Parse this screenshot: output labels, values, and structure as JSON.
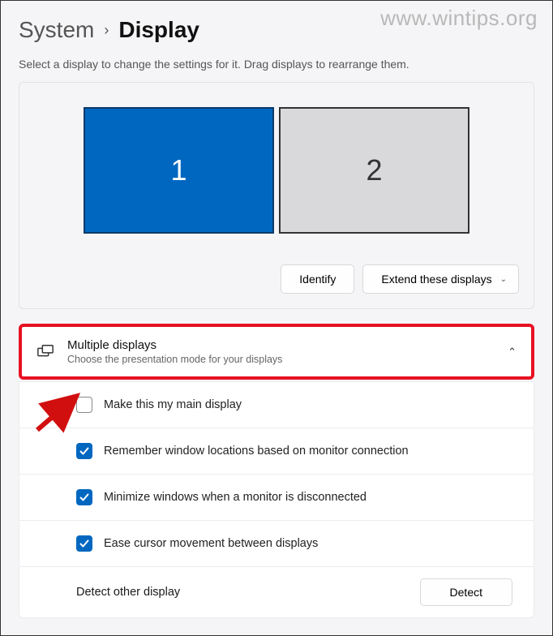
{
  "watermark": "www.wintips.org",
  "breadcrumb": {
    "parent": "System",
    "current": "Display"
  },
  "instruction": "Select a display to change the settings for it. Drag displays to rearrange them.",
  "monitors": {
    "m1": "1",
    "m2": "2"
  },
  "actions": {
    "identify": "Identify",
    "extend": "Extend these displays"
  },
  "section": {
    "title": "Multiple displays",
    "subtitle": "Choose the presentation mode for your displays"
  },
  "options": {
    "main_display": "Make this my main display",
    "remember_locations": "Remember window locations based on monitor connection",
    "minimize_disconnect": "Minimize windows when a monitor is disconnected",
    "ease_cursor": "Ease cursor movement between displays",
    "detect_label": "Detect other display",
    "detect_button": "Detect"
  }
}
